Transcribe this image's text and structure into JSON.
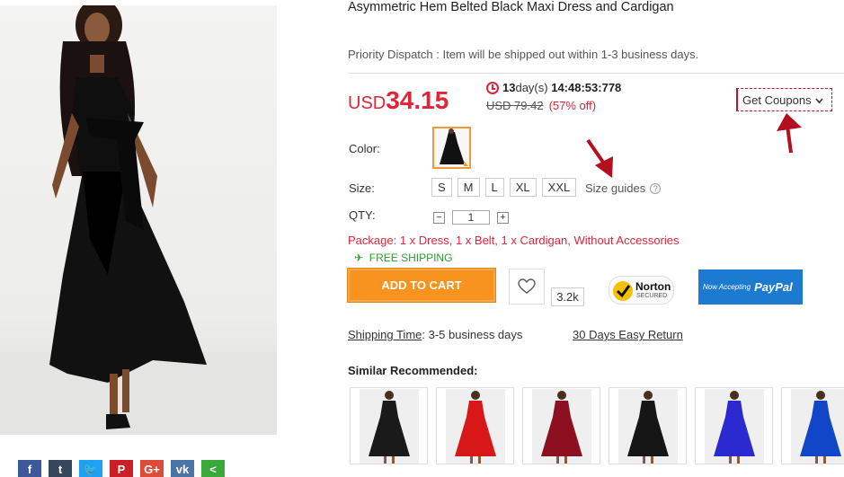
{
  "product": {
    "title": "Asymmetric Hem Belted Black Maxi Dress and Cardigan",
    "dispatch": "Priority Dispatch : Item will be shipped out within 1-3 business days."
  },
  "price": {
    "currency": "USD",
    "amount": "34.15",
    "timer_days": "13",
    "timer_days_label": "day(s)",
    "timer_time": "14:48:53:778",
    "old_price": "USD 79.42",
    "discount": "(57% off)"
  },
  "coupon": {
    "label": "Get Coupons"
  },
  "options": {
    "color_label": "Color:",
    "size_label": "Size:",
    "sizes": [
      "S",
      "M",
      "L",
      "XL",
      "XXL"
    ],
    "size_guide": "Size guides",
    "qty_label": "QTY:",
    "qty_value": "1",
    "minus": "−",
    "plus": "+"
  },
  "package": "Package: 1 x Dress, 1 x Belt, 1 x Cardigan, Without Accessories",
  "shipping": {
    "icon": "plane-icon",
    "label": "FREE SHIPPING"
  },
  "actions": {
    "add_to_cart": "ADD TO CART",
    "likes": "3.2k"
  },
  "badges": {
    "norton": "Norton",
    "norton_sub": "SECURED",
    "paypal_small": "Now Accepting",
    "paypal_big": "PayPal"
  },
  "info": {
    "shipping_time_label": "Shipping Time",
    "shipping_time_value": ": 3-5 business days",
    "returns": "30 Days Easy Return"
  },
  "similar": {
    "title": "Similar Recommended:",
    "items": [
      {
        "color": "#1a1a1a"
      },
      {
        "color": "#d81818"
      },
      {
        "color": "#8c1020"
      },
      {
        "color": "#161616"
      },
      {
        "color": "#2a2ad0"
      },
      {
        "color": "#1146c8"
      }
    ]
  },
  "share": [
    {
      "icon": "facebook-icon",
      "glyph": "f",
      "color": "#3b5998"
    },
    {
      "icon": "tumblr-icon",
      "glyph": "t",
      "color": "#36465d"
    },
    {
      "icon": "twitter-icon",
      "glyph": "🐦",
      "color": "#1da1f2"
    },
    {
      "icon": "pinterest-icon",
      "glyph": "P",
      "color": "#cb2027"
    },
    {
      "icon": "googleplus-icon",
      "glyph": "G+",
      "color": "#dd4b39"
    },
    {
      "icon": "vk-icon",
      "glyph": "vk",
      "color": "#4c75a3"
    },
    {
      "icon": "share-icon",
      "glyph": "<",
      "color": "#3aa83a"
    }
  ],
  "colors": {
    "accent": "#e0243a",
    "cart": "#f7931e",
    "free_shipping": "#2e9a2e",
    "paypal": "#1c7ad0"
  }
}
